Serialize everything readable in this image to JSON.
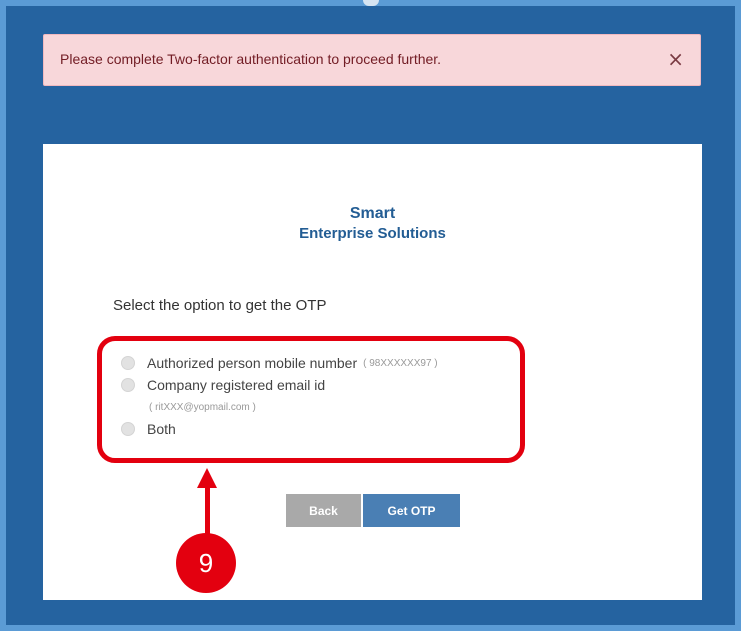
{
  "alert": {
    "message": "Please complete Two-factor authentication to proceed further.",
    "close_glyph": "×"
  },
  "brand": {
    "line1": "Smart",
    "line2": "Enterprise Solutions"
  },
  "otp": {
    "prompt": "Select the option to get the OTP",
    "options": [
      {
        "label": "Authorized person mobile number",
        "hint": "( 98XXXXXX97 )"
      },
      {
        "label": "Company registered email id",
        "hint": "( ritXXX@yopmail.com )"
      },
      {
        "label": "Both"
      }
    ]
  },
  "buttons": {
    "back": "Back",
    "get_otp": "Get OTP"
  },
  "annotation": {
    "step_number": "9",
    "color": "#e3000f"
  },
  "colors": {
    "frame": "#2563a0",
    "brand": "#235d94",
    "primary_button": "#4a7fb4",
    "secondary_button": "#a9a9a9",
    "alert_bg": "#f8d7da"
  }
}
